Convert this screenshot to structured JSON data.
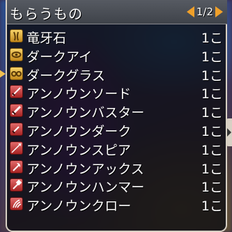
{
  "window": {
    "title": "もらうもの",
    "page": "1/2"
  },
  "items": [
    {
      "name": "竜牙石",
      "qty": "1こ",
      "icon": "fang-stone-icon",
      "icon_color": "gold"
    },
    {
      "name": "ダークアイ",
      "qty": "1こ",
      "icon": "eye-icon",
      "icon_color": "gold"
    },
    {
      "name": "ダークグラス",
      "qty": "1こ",
      "icon": "glasses-icon",
      "icon_color": "gold"
    },
    {
      "name": "アンノウンソード",
      "qty": "1こ",
      "icon": "sword-icon",
      "icon_color": "red"
    },
    {
      "name": "アンノウンバスター",
      "qty": "1こ",
      "icon": "greatsword-icon",
      "icon_color": "red"
    },
    {
      "name": "アンノウンダーク",
      "qty": "1こ",
      "icon": "dagger-icon",
      "icon_color": "red"
    },
    {
      "name": "アンノウンスピア",
      "qty": "1こ",
      "icon": "spear-icon",
      "icon_color": "red"
    },
    {
      "name": "アンノウンアックス",
      "qty": "1こ",
      "icon": "axe-icon",
      "icon_color": "red"
    },
    {
      "name": "アンノウンハンマー",
      "qty": "1こ",
      "icon": "hammer-icon",
      "icon_color": "red"
    },
    {
      "name": "アンノウンクロー",
      "qty": "1こ",
      "icon": "claw-icon",
      "icon_color": "red"
    }
  ],
  "colors": {
    "accent_arrow": "#f0a02a",
    "window_border": "#d8d0c4",
    "text": "#ffffff"
  }
}
